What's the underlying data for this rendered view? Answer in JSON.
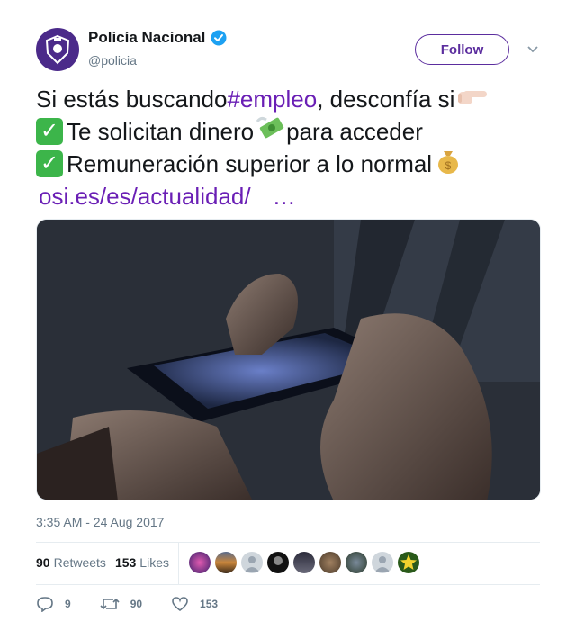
{
  "account": {
    "name": "Policía Nacional",
    "handle": "@policia",
    "verified": true
  },
  "follow_label": "Follow",
  "tweet": {
    "line1_a": "Si estás buscando ",
    "hashtag": "#empleo",
    "line1_b": ", desconfía si",
    "line2": "Te solicitan dinero",
    "line2_b": " para acceder",
    "line3": "Remuneración superior a lo normal",
    "link": "osi.es/es/actualidad/",
    "ellipsis": "…"
  },
  "timestamp": "3:35 AM - 24 Aug 2017",
  "stats": {
    "retweets_count": "90",
    "retweets_label": "Retweets",
    "likes_count": "153",
    "likes_label": "Likes"
  },
  "actions": {
    "reply_count": "9",
    "retweet_count": "90",
    "like_count": "153"
  },
  "colors": {
    "accent": "#5b2d9e",
    "link": "#6a1fb5",
    "verified": "#1da1f2",
    "check": "#3cb54a"
  },
  "icons": [
    "police-badge-icon",
    "verified-icon",
    "chevron-down-icon",
    "pointing-hand-icon",
    "check-icon",
    "money-wings-icon",
    "money-bag-icon",
    "reply-icon",
    "retweet-icon",
    "heart-icon"
  ]
}
